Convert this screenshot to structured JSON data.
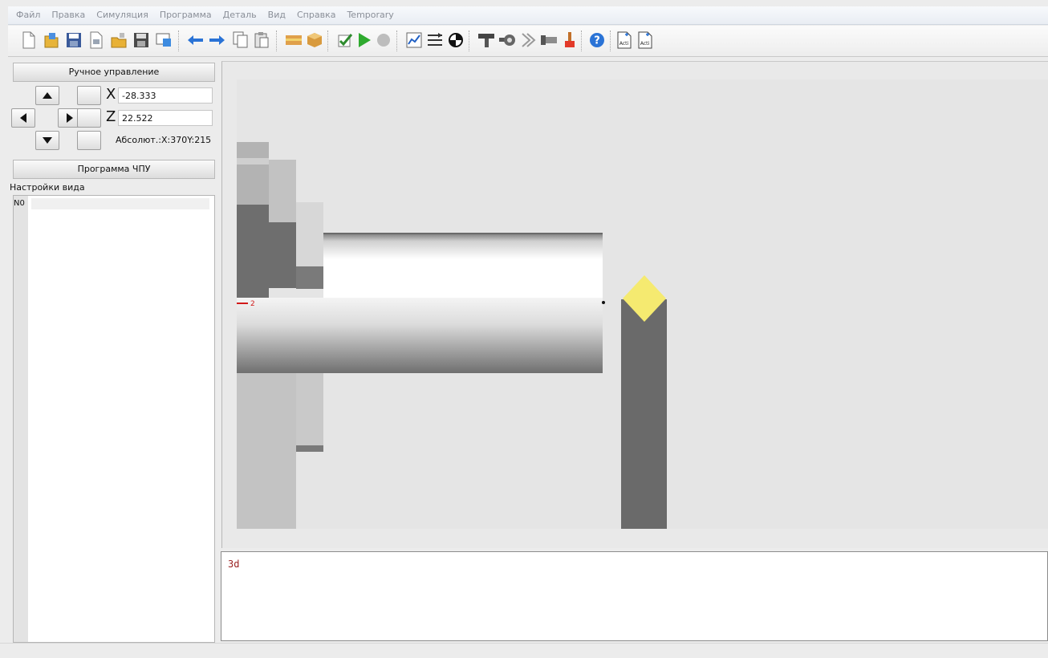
{
  "menu": [
    "Файл",
    "Правка",
    "Симуляция",
    "Программа",
    "Деталь",
    "Вид",
    "Справка",
    "Temporary"
  ],
  "toolbar": {
    "groups": [
      [
        "new-file",
        "open-file",
        "save-file",
        "export-file",
        "open-folder",
        "save-as",
        "print-preview"
      ],
      [
        "undo",
        "redo",
        "copy",
        "paste"
      ],
      [
        "stock-material",
        "3d-box"
      ],
      [
        "check-program",
        "run-simulation",
        "stop-simulation"
      ],
      [
        "chart-settings",
        "parallel-lines",
        "origin-point"
      ],
      [
        "tool-holder",
        "tool-turret",
        "chevron-right",
        "bar-feeder",
        "paint-brush"
      ],
      [
        "help"
      ],
      [
        "acti-file-1",
        "acti-file-2"
      ]
    ],
    "acti_label": "Acti"
  },
  "manual": {
    "title": "Ручное управление",
    "x_label": "X",
    "z_label": "Z",
    "x_value": "-28.333",
    "z_value": "22.522",
    "absolute": "Абсолют.:X:370Y:215"
  },
  "cnc": {
    "title": "Программа ЧПУ",
    "view_settings": "Настройки вида",
    "lines": [
      "N0"
    ]
  },
  "viewport": {
    "axis_label": "2"
  },
  "console": {
    "text": "3d"
  },
  "colors": {
    "insert": "#f5ea70",
    "toolbar_blue": "#2a73d6",
    "run_green": "#2faa2f",
    "axis_red": "#d11a1a"
  }
}
